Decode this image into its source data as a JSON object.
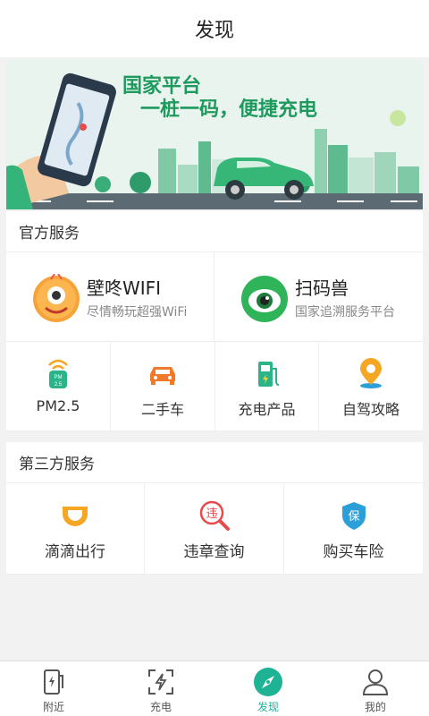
{
  "header": {
    "title": "发现"
  },
  "banner": {
    "line1": "国家平台",
    "line2": "一桩一码，便捷充电"
  },
  "official": {
    "title": "官方服务",
    "big_items": [
      {
        "title": "壁咚WIFI",
        "subtitle": "尽情畅玩超强WiFi",
        "icon": "monster-icon"
      },
      {
        "title": "扫码兽",
        "subtitle": "国家追溯服务平台",
        "icon": "eye-icon"
      }
    ],
    "small_items": [
      {
        "label": "PM2.5",
        "icon": "pm25-icon",
        "icon_text": "PM 2.5"
      },
      {
        "label": "二手车",
        "icon": "car-icon"
      },
      {
        "label": "充电产品",
        "icon": "charger-icon"
      },
      {
        "label": "自驾攻略",
        "icon": "location-pin-icon"
      }
    ]
  },
  "third": {
    "title": "第三方服务",
    "items": [
      {
        "label": "滴滴出行",
        "icon": "didi-icon"
      },
      {
        "label": "违章查询",
        "icon": "violation-search-icon",
        "icon_text": "违"
      },
      {
        "label": "购买车险",
        "icon": "insurance-shield-icon",
        "icon_text": "保"
      }
    ]
  },
  "tabbar": {
    "tabs": [
      {
        "label": "附近",
        "icon": "nearby-charger-icon",
        "active": false
      },
      {
        "label": "充电",
        "icon": "scan-charge-icon",
        "active": false
      },
      {
        "label": "发现",
        "icon": "compass-icon",
        "active": true
      },
      {
        "label": "我的",
        "icon": "user-icon",
        "active": false
      }
    ]
  },
  "colors": {
    "accent": "#1db394",
    "orange": "#f5a623",
    "blue": "#2a9fd8",
    "red": "#e8494b"
  }
}
